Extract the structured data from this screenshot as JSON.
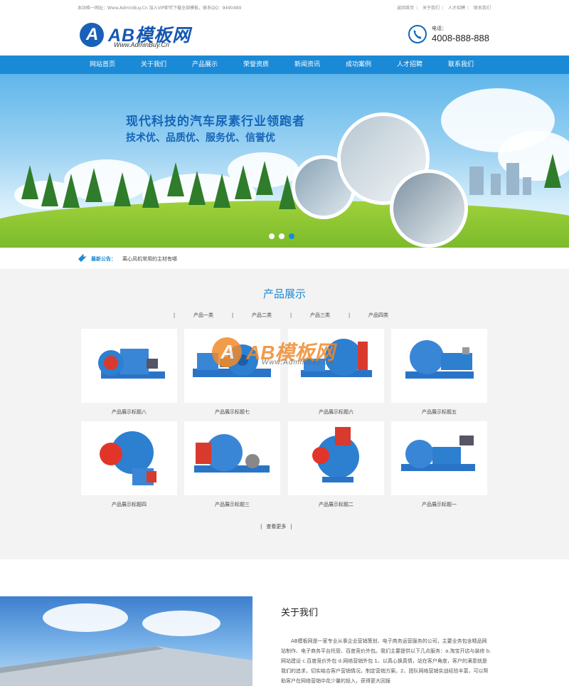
{
  "topbar": {
    "welcome": "本站唯一网址：Www.AdminBuy.Cn 加入VIP即可下载全部模板，联系QQ：9490489",
    "links": [
      "返回首页",
      "关于我们",
      "人才招聘",
      "联系我们"
    ]
  },
  "header": {
    "logo_text": "AB模板网",
    "logo_sub": "Www.AdminBuy.Cn",
    "phone_label": "电话：",
    "phone_number": "4008-888-888"
  },
  "nav": [
    "网站首页",
    "关于我们",
    "产品展示",
    "荣誉资质",
    "新闻资讯",
    "成功案例",
    "人才招聘",
    "联系我们"
  ],
  "banner": {
    "headline": "现代科技的汽车尿素行业领跑者",
    "subline": "技术优、品质优、服务优、信誉优",
    "slide_count": 3,
    "active_slide": 3
  },
  "notice": {
    "label": "最新公告：",
    "text": "离心风机常用的主材有哪"
  },
  "products": {
    "title": "产品展示",
    "tabs": [
      "产品一类",
      "产品二类",
      "产品三类",
      "产品四类"
    ],
    "items": [
      {
        "caption": "产品展示标题八"
      },
      {
        "caption": "产品展示标题七"
      },
      {
        "caption": "产品展示标题六"
      },
      {
        "caption": "产品展示标题五"
      },
      {
        "caption": "产品展示标题四"
      },
      {
        "caption": "产品展示标题三"
      },
      {
        "caption": "产品展示标题二"
      },
      {
        "caption": "产品展示标题一"
      }
    ],
    "more_label": "查看更多",
    "watermark_text": "AB模板网",
    "watermark_sub": "Www.AdminBuy.Cn"
  },
  "about": {
    "title": "关于我们",
    "text": "AB模板网是一家专业从事企业营销策划、电子商务运营服务的公司，主要业务包含精品网站制作、电子商务平台托管、百度竞价外包。我们主要提供以下几点服务：a.淘宝开店与装修 b.网站建设 c.百度竞价外包 d.网络营销外包 1、以真心换真情，站在客户角度，客户的满意就是我们的追求，切实结合客户营销情况，制定营销方案。2、团队网络营销实战经验丰富，可以帮助客户在网络营销中花少量的投入，获得更大回报"
  },
  "colors": {
    "brand": "#1b8ad6",
    "logo_blue": "#1557b3",
    "watermark_orange": "#f08a2c"
  }
}
